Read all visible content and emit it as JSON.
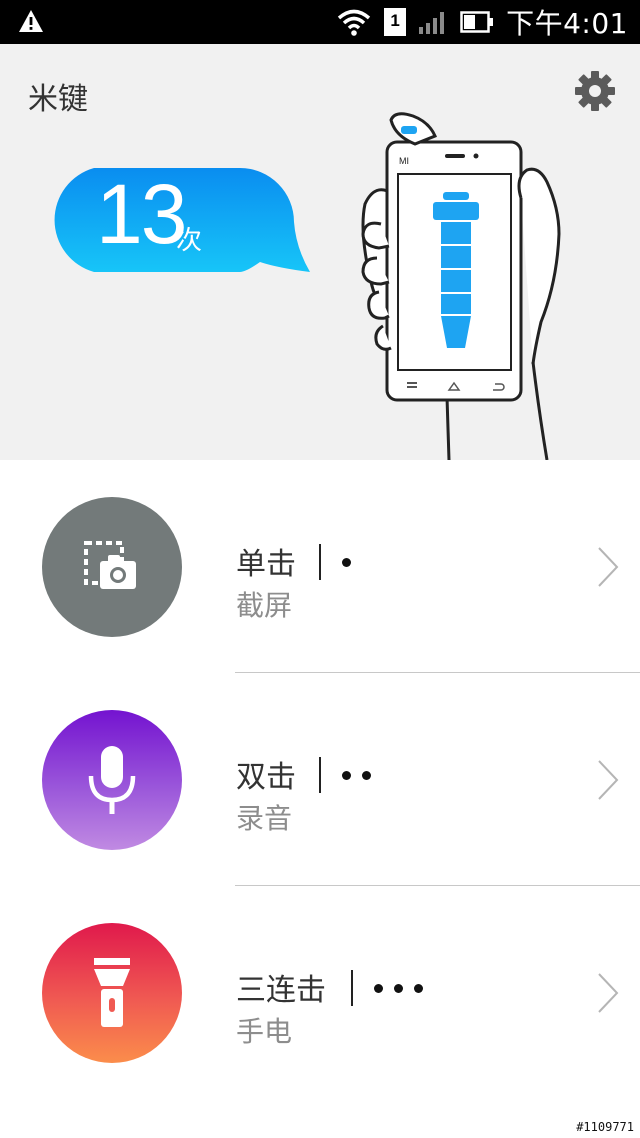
{
  "status_bar": {
    "time": "下午4:01",
    "sim_slot": "1",
    "icons": [
      "warning-icon",
      "wifi-icon",
      "sim-icon",
      "signal-icon",
      "battery-icon"
    ]
  },
  "header": {
    "title": "米键",
    "count": "13",
    "count_unit": "次",
    "phone_brand": "MI"
  },
  "actions": [
    {
      "gesture": "单击",
      "dots": 1,
      "function": "截屏",
      "icon": "screenshot-icon",
      "color": "#737a7a"
    },
    {
      "gesture": "双击",
      "dots": 2,
      "function": "录音",
      "icon": "microphone-icon",
      "color": "#8a3ad6"
    },
    {
      "gesture": "三连击",
      "dots": 3,
      "function": "手电",
      "icon": "flashlight-icon",
      "color": "#f05a52"
    }
  ],
  "watermark": "#1109771",
  "colors": {
    "bubble": "#1aa0f5",
    "accent_blue": "#1ea4f2",
    "header_bg": "#f1f1f1"
  }
}
